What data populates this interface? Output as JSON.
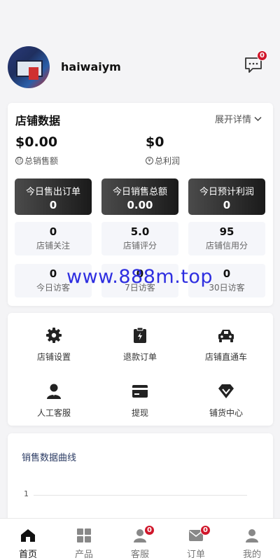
{
  "header": {
    "username": "haiwaiym",
    "message_badge": "0"
  },
  "store": {
    "title": "店铺数据",
    "expand_label": "展开详情",
    "total_sales": {
      "value": "$0.00",
      "label": "总销售额",
      "icon_glyph": "巳"
    },
    "total_profit": {
      "value": "$0",
      "label": "总利润",
      "icon_glyph": "¥"
    },
    "highlights": [
      {
        "label": "今日售出订单",
        "value": "0"
      },
      {
        "label": "今日销售总额",
        "value": "0.00"
      },
      {
        "label": "今日预计利润",
        "value": "0"
      }
    ],
    "stats": [
      {
        "label": "店铺关注",
        "value": "0"
      },
      {
        "label": "店铺评分",
        "value": "5.0"
      },
      {
        "label": "店铺信用分",
        "value": "95"
      },
      {
        "label": "今日访客",
        "value": "0"
      },
      {
        "label": "7日访客",
        "value": "0"
      },
      {
        "label": "30日访客",
        "value": "0"
      }
    ]
  },
  "watermark": "www.888m.top",
  "menu": [
    {
      "label": "店铺设置",
      "icon": "gear-icon"
    },
    {
      "label": "退款订单",
      "icon": "refund-clipboard-icon"
    },
    {
      "label": "店铺直通车",
      "icon": "car-icon"
    },
    {
      "label": "人工客服",
      "icon": "agent-icon"
    },
    {
      "label": "提现",
      "icon": "card-icon"
    },
    {
      "label": "铺货中心",
      "icon": "diamond-icon"
    }
  ],
  "chart": {
    "title": "销售数据曲线",
    "y_tick": "1"
  },
  "tabs": [
    {
      "label": "首页",
      "icon": "home-icon",
      "active": true
    },
    {
      "label": "产品",
      "icon": "grid-icon"
    },
    {
      "label": "客服",
      "icon": "service-icon",
      "badge": "0"
    },
    {
      "label": "订单",
      "icon": "mail-icon",
      "badge": "0"
    },
    {
      "label": "我的",
      "icon": "user-icon"
    }
  ],
  "colors": {
    "badge": "#d0162a",
    "watermark": "#2e2ee0",
    "dark_box_start": "#4b4b4b",
    "dark_box_end": "#1a1a1a"
  }
}
